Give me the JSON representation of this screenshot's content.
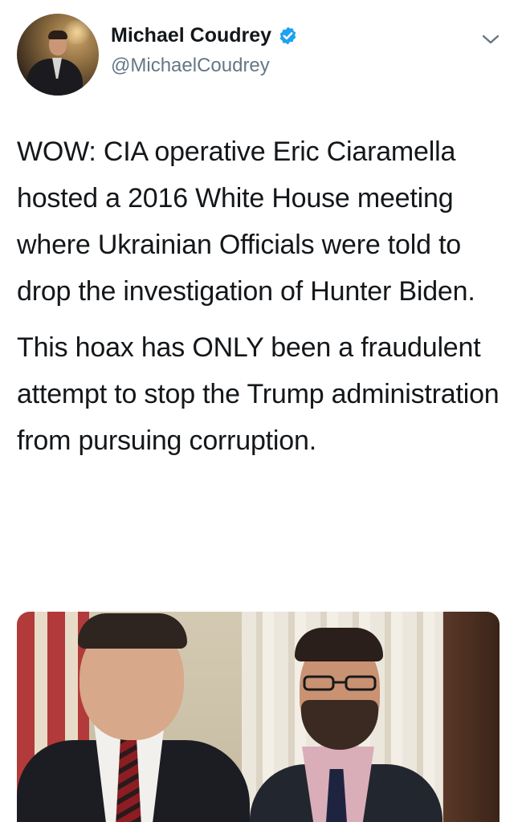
{
  "author": {
    "name": "Michael Coudrey",
    "handle": "@MichaelCoudrey",
    "verified": true,
    "verified_icon": "verified-badge-icon",
    "verified_color": "#1da1f2"
  },
  "menu_icon": "chevron-down-icon",
  "tweet": {
    "paragraphs": [
      "WOW: CIA operative Eric Ciaramella hosted a 2016 White House meeting where Ukrainian Officials were told to drop the investigation of Hunter Biden.",
      "This hoax has ONLY been a fraudulent attempt to stop the Trump administration from pursuing corruption."
    ]
  },
  "media": {
    "type": "photo"
  },
  "colors": {
    "text": "#14171a",
    "secondary": "#657786",
    "accent": "#1da1f2"
  }
}
